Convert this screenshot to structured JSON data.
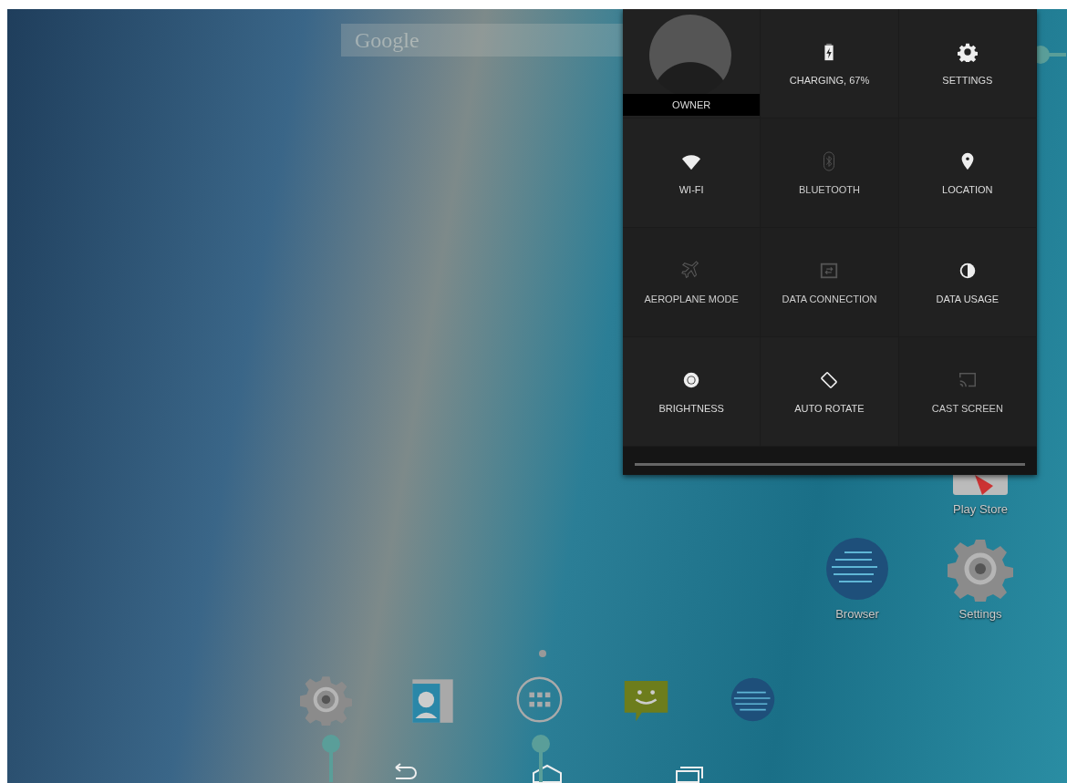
{
  "search": {
    "placeholder": "Google"
  },
  "quick_settings": {
    "user": {
      "label": "OWNER"
    },
    "tiles": [
      {
        "kind": "battery",
        "label": "CHARGING, 67%",
        "on": true
      },
      {
        "kind": "settings",
        "label": "SETTINGS",
        "on": true
      },
      {
        "kind": "wifi",
        "label": "WI-FI",
        "on": true
      },
      {
        "kind": "bluetooth",
        "label": "BLUETOOTH",
        "on": false
      },
      {
        "kind": "location",
        "label": "LOCATION",
        "on": true
      },
      {
        "kind": "aeroplane",
        "label": "AEROPLANE MODE",
        "on": false
      },
      {
        "kind": "data",
        "label": "DATA CONNECTION",
        "on": false
      },
      {
        "kind": "usage",
        "label": "DATA USAGE",
        "on": true
      },
      {
        "kind": "brightness",
        "label": "BRIGHTNESS",
        "on": true
      },
      {
        "kind": "rotate",
        "label": "AUTO ROTATE",
        "on": true
      },
      {
        "kind": "cast",
        "label": "CAST SCREEN",
        "on": false
      }
    ]
  },
  "home_apps": [
    {
      "kind": "play",
      "label": "Play Store"
    },
    {
      "kind": "browser",
      "label": "Browser"
    },
    {
      "kind": "settings",
      "label": "Settings"
    }
  ],
  "dock": [
    {
      "kind": "settings"
    },
    {
      "kind": "contacts"
    },
    {
      "kind": "apps"
    },
    {
      "kind": "messaging"
    },
    {
      "kind": "browser"
    }
  ]
}
